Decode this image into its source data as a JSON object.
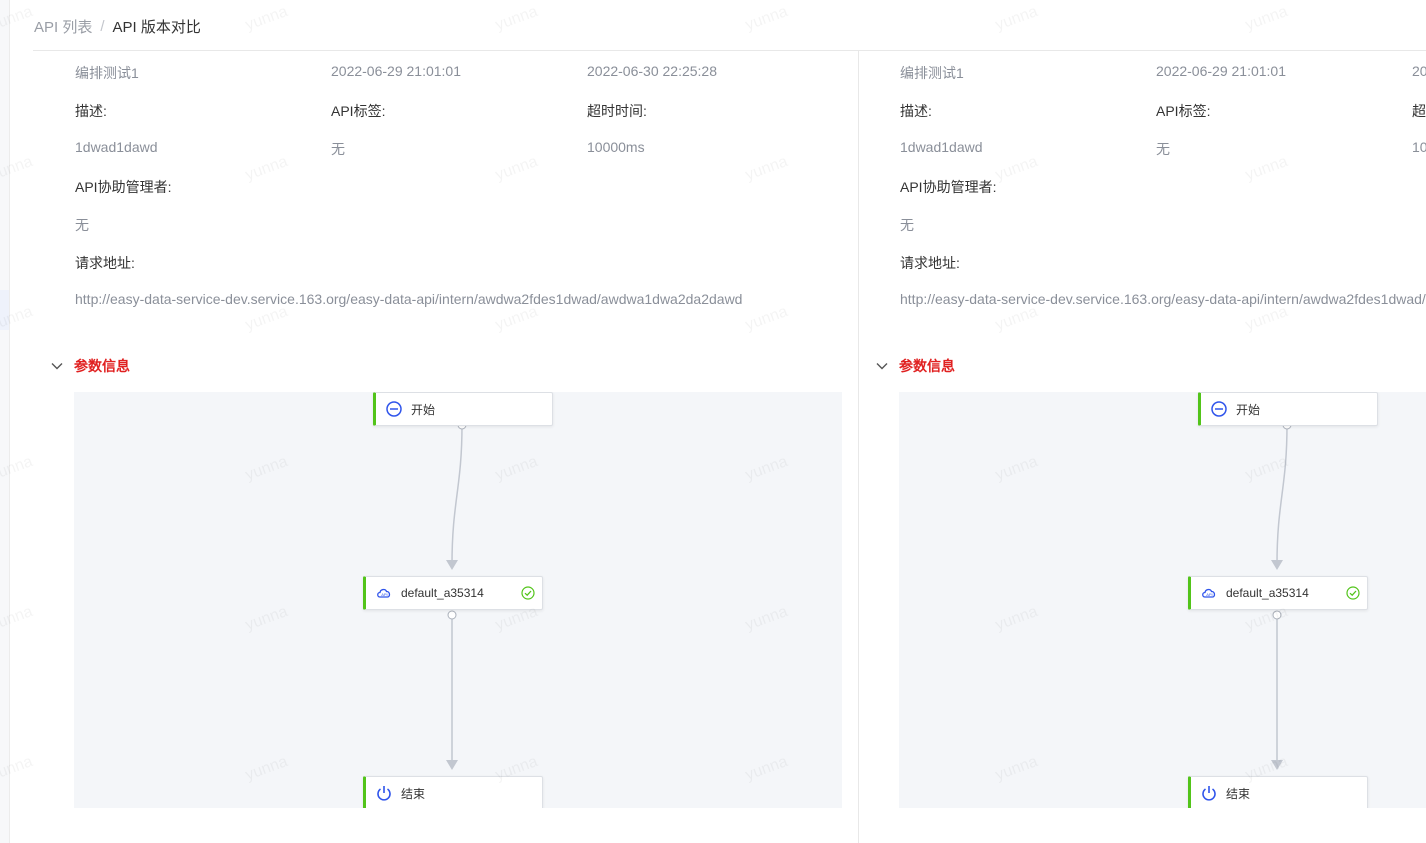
{
  "breadcrumb": {
    "parent": "API 列表",
    "separator": "/",
    "current": "API 版本对比"
  },
  "watermark": "yunna",
  "panels": [
    {
      "name": "编排测试1",
      "created": "2022-06-29 21:01:01",
      "updated": "2022-06-30 22:25:28",
      "desc_label": "描述:",
      "tag_label": "API标签:",
      "timeout_label": "超时时间:",
      "desc_value": "1dwad1dawd",
      "tag_value": "无",
      "timeout_value": "10000ms",
      "manager_label": "API协助管理者:",
      "manager_value": "无",
      "url_label": "请求地址:",
      "url_value": "http://easy-data-service-dev.service.163.org/easy-data-api/intern/awdwa2fdes1dwad/awdwa1dwa2da2dawd",
      "section_title": "参数信息",
      "flow": {
        "start": "开始",
        "api": "default_a35314",
        "end": "结束"
      }
    },
    {
      "name": "编排测试1",
      "created": "2022-06-29 21:01:01",
      "updated": "20",
      "desc_label": "描述:",
      "tag_label": "API标签:",
      "timeout_label": "超",
      "desc_value": "1dwad1dawd",
      "tag_value": "无",
      "timeout_value": "10",
      "manager_label": "API协助管理者:",
      "manager_value": "无",
      "url_label": "请求地址:",
      "url_value": "http://easy-data-service-dev.service.163.org/easy-data-api/intern/awdwa2fdes1dwad/",
      "section_title": "参数信息",
      "flow": {
        "start": "开始",
        "api": "default_a35314",
        "end": "结束"
      }
    }
  ],
  "colors": {
    "accent": "#52c41a",
    "section_title": "#e02020",
    "icon_blue": "#2f54eb",
    "canvas_bg": "#f4f6f9"
  }
}
